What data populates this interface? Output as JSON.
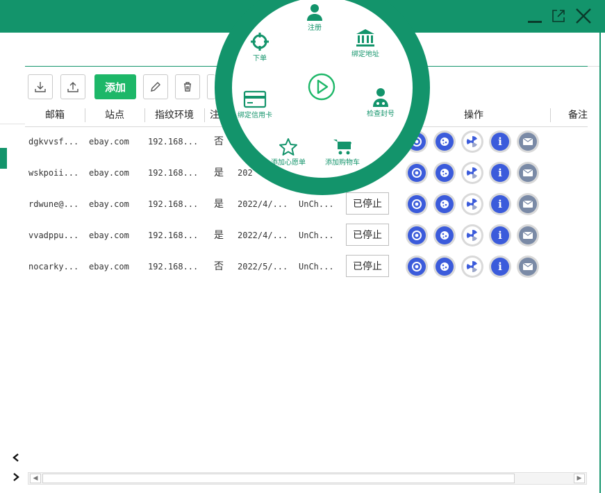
{
  "window": {
    "minimize_icon": "minimize-icon",
    "popout_icon": "popout-icon",
    "close_icon": "close-icon",
    "accent_color": "#13946b"
  },
  "toolbar": {
    "import_icon": "download-icon",
    "export_icon": "upload-icon",
    "add_label": "添加",
    "edit_icon": "pencil-icon",
    "delete_icon": "trash-icon"
  },
  "table": {
    "columns": [
      "邮箱",
      "站点",
      "指纹环境",
      "注",
      "操作",
      "备注"
    ],
    "rows": [
      {
        "email": "dgkvvsf...",
        "site": "ebay.com",
        "env": "192.168...",
        "registered": "否",
        "date": "",
        "ua": "",
        "status": ""
      },
      {
        "email": "wskpoii...",
        "site": "ebay.com",
        "env": "192.168...",
        "registered": "是",
        "date": "202",
        "ua": "",
        "status": ""
      },
      {
        "email": "rdwune@...",
        "site": "ebay.com",
        "env": "192.168...",
        "registered": "是",
        "date": "2022/4/...",
        "ua": "UnCh...",
        "status": "已停止"
      },
      {
        "email": "vvadppu...",
        "site": "ebay.com",
        "env": "192.168...",
        "registered": "是",
        "date": "2022/4/...",
        "ua": "UnCh...",
        "status": "已停止"
      },
      {
        "email": "nocarky...",
        "site": "ebay.com",
        "env": "192.168...",
        "registered": "否",
        "date": "2022/5/...",
        "ua": "UnCh...",
        "status": "已停止"
      }
    ],
    "op_icons": [
      "chrome-icon",
      "cookie-icon",
      "radiation-icon",
      "info-icon",
      "mail-icon"
    ]
  },
  "nav": {
    "prev_icon": "chevron-left-icon",
    "next_icon": "chevron-right-icon"
  },
  "radial_menu": {
    "center_icon": "play-icon",
    "items": [
      {
        "icon": "user-icon",
        "label": "注册"
      },
      {
        "icon": "bank-icon",
        "label": "绑定地址"
      },
      {
        "icon": "doctor-icon",
        "label": "检查封号"
      },
      {
        "icon": "cart-icon",
        "label": "添加购物车"
      },
      {
        "icon": "star-icon",
        "label": "添加心愿单"
      },
      {
        "icon": "credit-card-icon",
        "label": "绑定信用卡"
      },
      {
        "icon": "crosshair-icon",
        "label": "下单"
      }
    ]
  }
}
